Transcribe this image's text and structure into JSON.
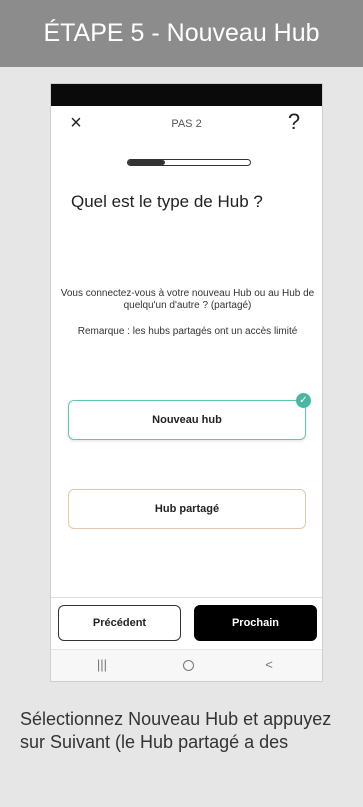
{
  "banner": {
    "title": "ÉTAPE 5 - Nouveau Hub"
  },
  "phone": {
    "header": {
      "close_glyph": "×",
      "step_label": "PAS 2",
      "help_glyph": "?"
    },
    "progress": {
      "fraction": 0.3
    },
    "question": "Quel est le type de Hub ?",
    "description": "Vous connectez-vous à votre nouveau Hub ou au Hub de quelqu'un d'autre ? (partagé)",
    "note": "Remarque : les hubs partagés ont un accès limité",
    "options": [
      {
        "label": "Nouveau hub",
        "selected": true
      },
      {
        "label": "Hub partagé",
        "selected": false
      }
    ],
    "buttons": {
      "previous": "Précédent",
      "next": "Prochain"
    },
    "navbar": {
      "recents_glyph": "|||",
      "back_glyph": "<"
    }
  },
  "instruction": "Sélectionnez Nouveau Hub et appuyez sur Suivant (le Hub partagé a des",
  "colors": {
    "banner": "#8c8c8c",
    "accent": "#49b89f",
    "shared_border": "#e3c9a5"
  }
}
